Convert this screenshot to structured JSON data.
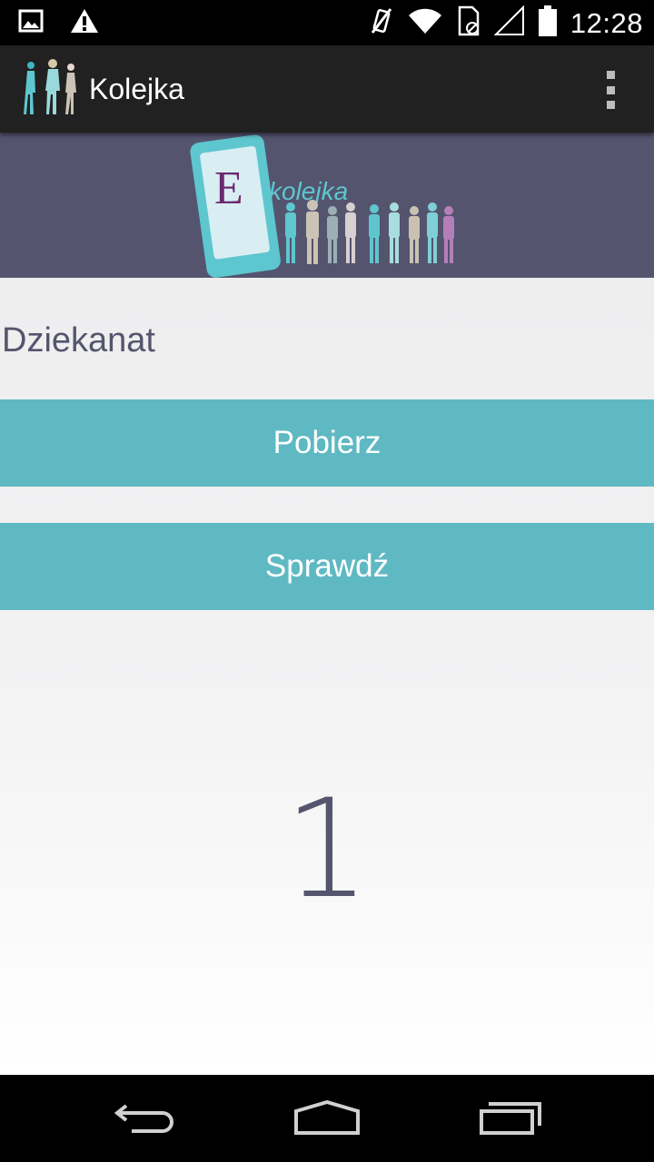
{
  "status_bar": {
    "time": "12:28",
    "icons": [
      "image-notification-icon",
      "warning-icon",
      "mute-icon",
      "wifi-icon",
      "sim-icon",
      "signal-icon",
      "battery-icon"
    ]
  },
  "action_bar": {
    "title": "Kolejka",
    "app_icon": "queue-people-logo-icon",
    "menu_icon": "overflow-menu-icon"
  },
  "banner": {
    "logo_letter": "E",
    "logo_text": "kolejka"
  },
  "main": {
    "office_label": "Dziekanat",
    "fetch_button_label": "Pobierz",
    "check_button_label": "Sprawdź",
    "queue_number": "1"
  },
  "nav_bar": {
    "icons": [
      "back-icon",
      "home-icon",
      "recents-icon"
    ]
  },
  "colors": {
    "accent": "#5fb9c3",
    "banner_bg": "#54546e",
    "text_primary": "#55556d",
    "action_bar_bg": "#212121"
  }
}
